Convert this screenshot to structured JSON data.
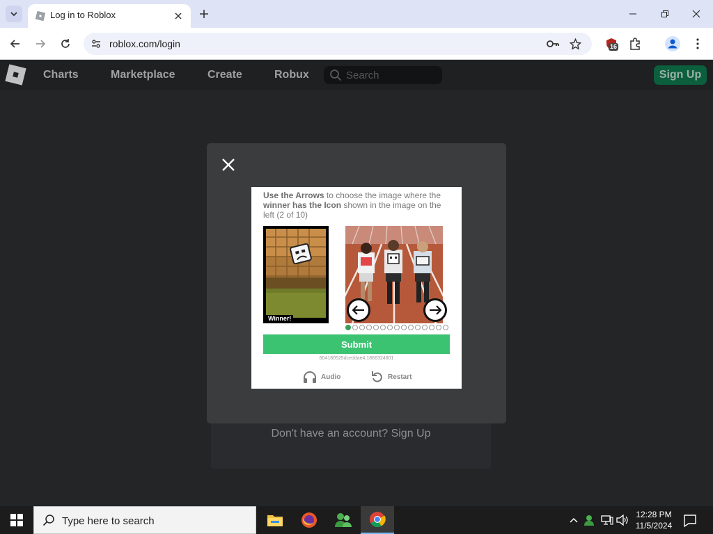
{
  "browser": {
    "tab_title": "Log in to Roblox",
    "url": "roblox.com/login",
    "extension_badge": "16"
  },
  "roblox_nav": {
    "links": [
      "Charts",
      "Marketplace",
      "Create",
      "Robux"
    ],
    "search_placeholder": "Search",
    "signup_label": "Sign Up"
  },
  "page": {
    "no_account_text": "Don't have an account? Sign Up"
  },
  "captcha": {
    "instruction_bold_1": "Use the Arrows",
    "instruction_text_1": " to choose the image where the ",
    "instruction_bold_2": "winner has the Icon",
    "instruction_text_2": " shown in the image on the left  (2 of 10)",
    "winner_label": "Winner!",
    "total_images": 15,
    "current_image": 1,
    "submit_label": "Submit",
    "session_id": "604180525dceddae4.1866324601",
    "audio_label": "Audio",
    "restart_label": "Restart"
  },
  "taskbar": {
    "search_placeholder": "Type here to search",
    "time": "12:28 PM",
    "date": "11/5/2024"
  },
  "colors": {
    "submit_green": "#3cc372",
    "signup_green": "#0b5f3d",
    "modal_bg": "#3b3c3e",
    "page_bg": "#232527"
  }
}
